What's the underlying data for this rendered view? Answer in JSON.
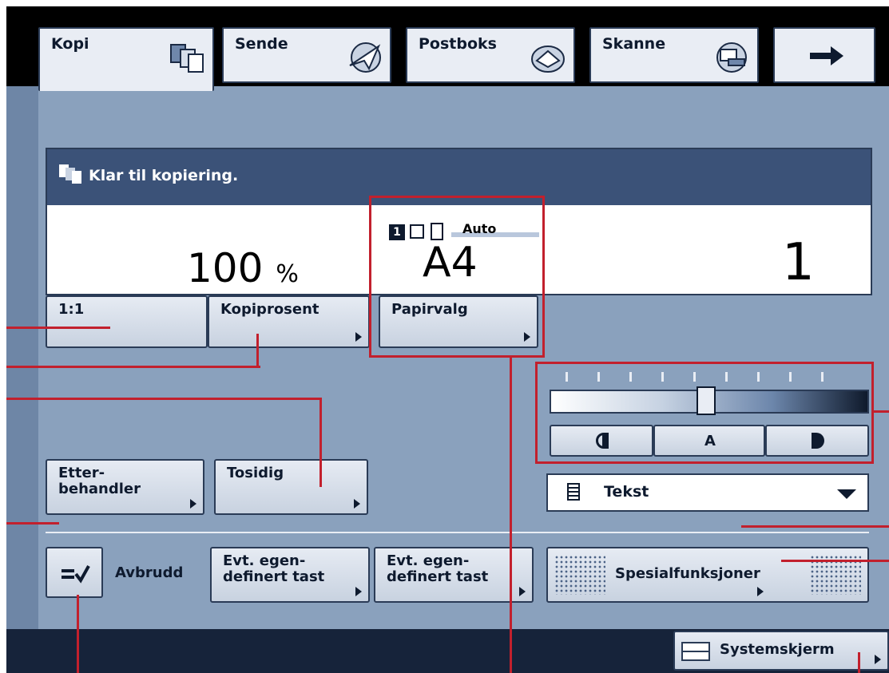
{
  "tabs": {
    "kopi": "Kopi",
    "sende": "Sende",
    "postboks": "Postboks",
    "skanne": "Skanne",
    "more_icon": "right-arrow-icon"
  },
  "status": {
    "message": "Klar til kopiering.",
    "zoom_value": "100",
    "zoom_unit": "%",
    "paper_size": "A4",
    "paper_auto": "Auto",
    "copies": "1"
  },
  "buttons": {
    "one_to_one": "1:1",
    "copy_ratio": "Kopiprosent",
    "paper_select": "Papirvalg",
    "finisher": "Etter-\nbehandler",
    "two_sided": "Tosidig",
    "interrupt": "Avbrudd",
    "custom_key_1": "Evt. egen-\ndefinert tast",
    "custom_key_2": "Evt. egen-\ndefinert tast",
    "special_features": "Spesialfunksjoner",
    "system_monitor": "Systemskjerm"
  },
  "density": {
    "lighter_icon": "half-circle-left-icon",
    "auto_label": "A",
    "darker_icon": "half-circle-right-icon",
    "level_fraction": 0.5
  },
  "image_mode": {
    "selected": "Tekst"
  },
  "colors": {
    "panel": "#8aa1bd",
    "status_header": "#3b5278",
    "annotation": "#c2202d"
  }
}
